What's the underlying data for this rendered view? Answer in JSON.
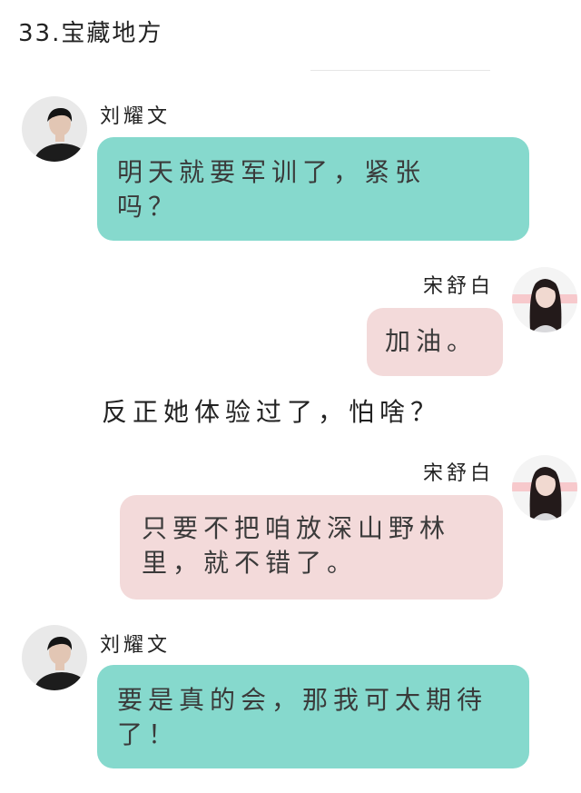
{
  "title": "33.宝藏地方",
  "messages": [
    {
      "sender": "刘耀文",
      "text": "明天就要军训了，紧张吗？",
      "side": "left",
      "color": "#86d9cd"
    },
    {
      "sender": "宋舒白",
      "text": "加油。",
      "side": "right",
      "color": "#f3dada"
    },
    {
      "sender": "宋舒白",
      "text": "只要不把咱放深山野林里，就不错了。",
      "side": "right",
      "color": "#f3dada"
    },
    {
      "sender": "刘耀文",
      "text": "要是真的会，那我可太期待了！",
      "side": "left",
      "color": "#86d9cd"
    }
  ],
  "narration": "反正她体验过了，怕啥？"
}
